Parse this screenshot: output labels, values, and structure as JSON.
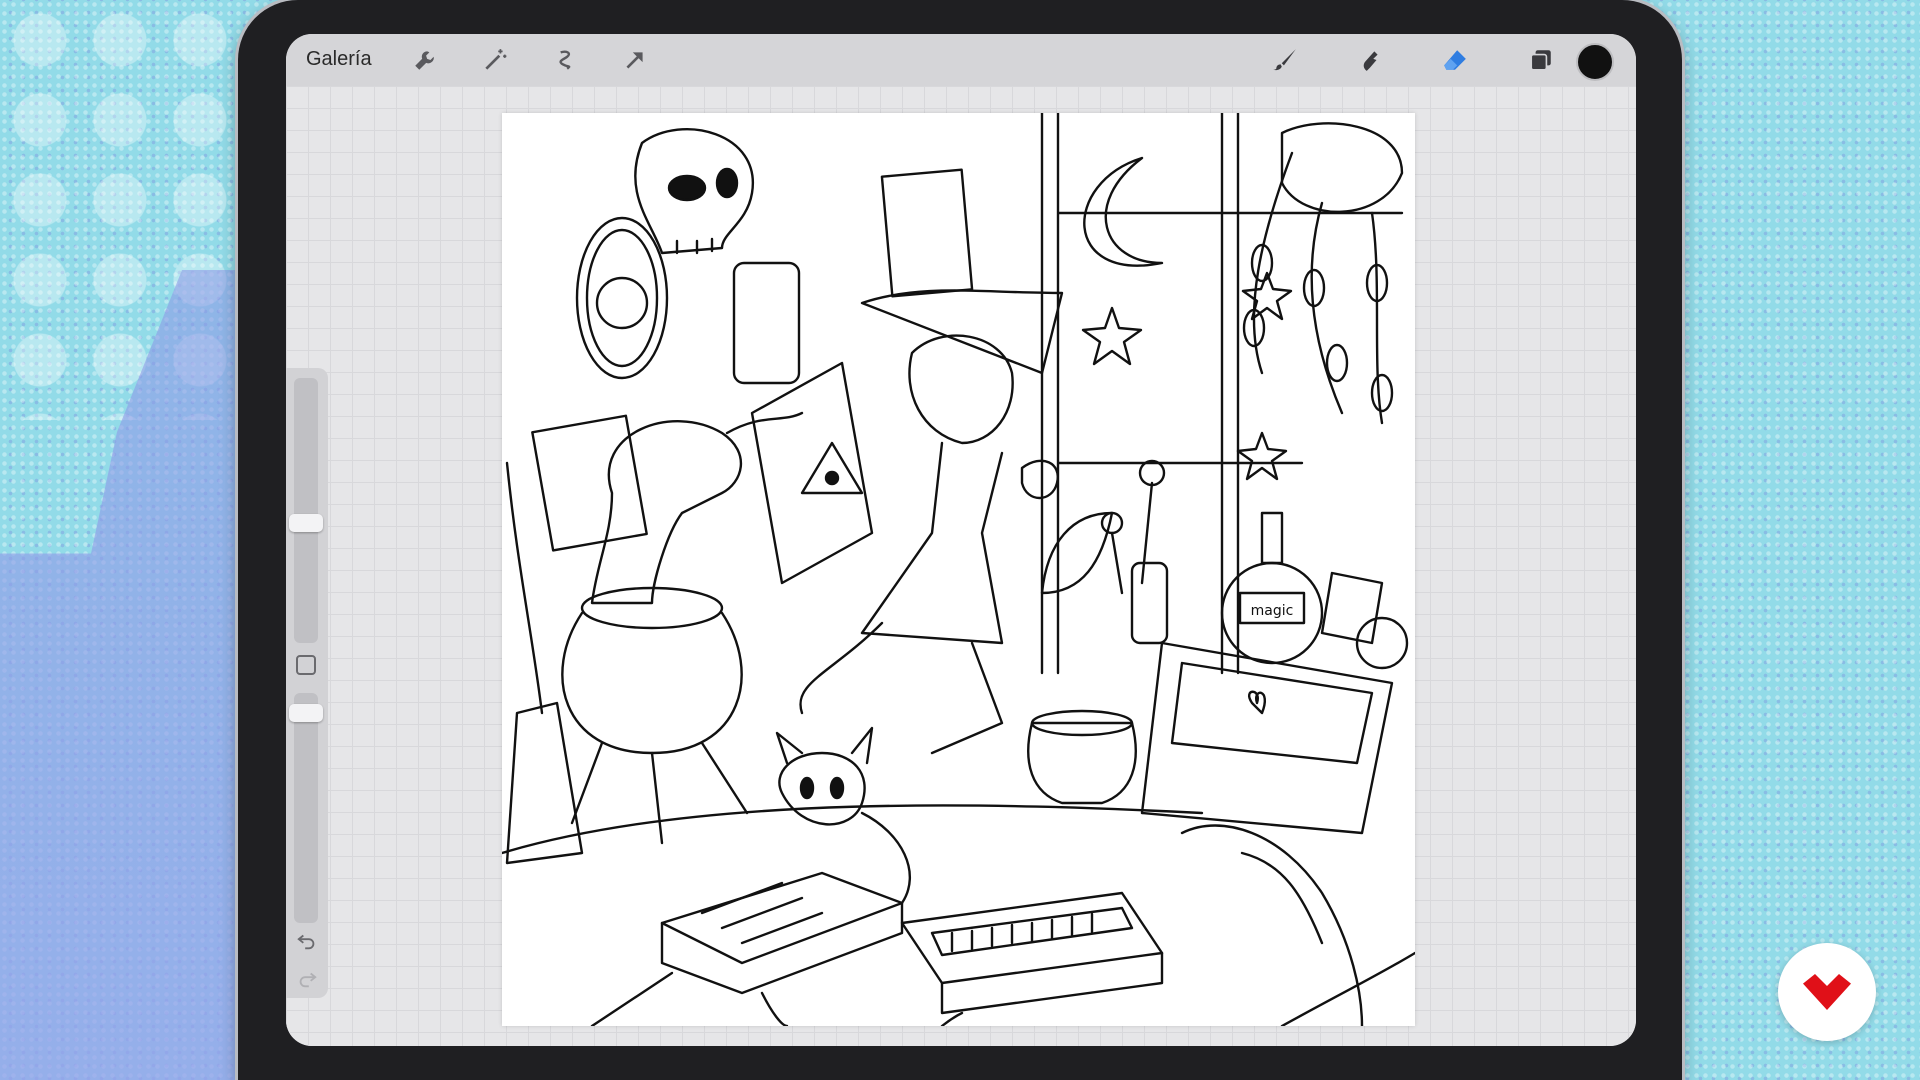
{
  "toolbar": {
    "gallery_label": "Galería",
    "left_tools": [
      {
        "icon": "wrench-icon"
      },
      {
        "icon": "magic-wand-icon"
      },
      {
        "icon": "selection-icon"
      },
      {
        "icon": "transform-arrow-icon"
      }
    ],
    "right_tools": [
      {
        "icon": "brush-icon"
      },
      {
        "icon": "smudge-icon"
      },
      {
        "icon": "eraser-icon",
        "active": true
      },
      {
        "icon": "layers-icon"
      }
    ],
    "current_color": "#111111",
    "active_color": "#2f7de1"
  },
  "sidebar": {
    "brush_size_level": 0.45,
    "opacity_level": 0.95,
    "controls": [
      {
        "icon": "modify-square-icon"
      },
      {
        "icon": "undo-icon"
      },
      {
        "icon": "redo-icon"
      }
    ]
  },
  "canvas": {
    "label_magic": "magic"
  },
  "overlay": {
    "logo_icon": "brand-logo-icon",
    "logo_color": "#e01018"
  }
}
